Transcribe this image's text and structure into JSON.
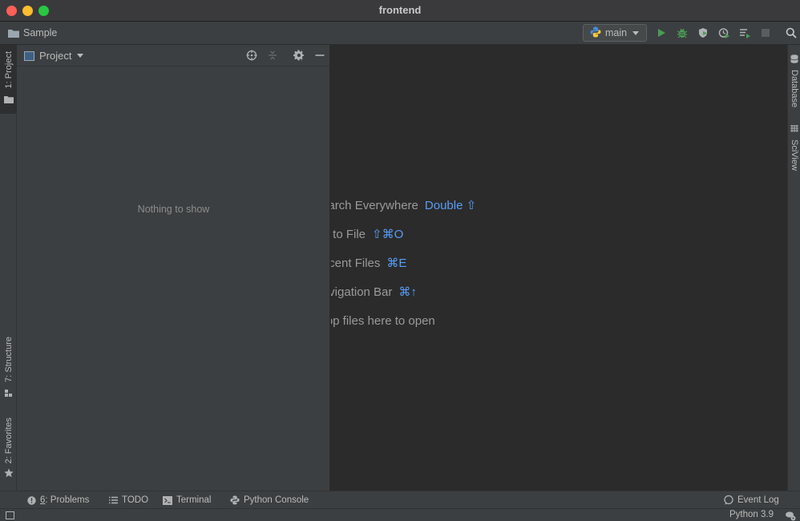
{
  "window": {
    "title": "frontend"
  },
  "navbar": {
    "breadcrumb": "Sample",
    "breadcrumb_icon": "folder-icon",
    "run_config": "main",
    "run_config_icon": "python-icon",
    "actions": [
      "run-icon",
      "debug-icon",
      "coverage-icon",
      "profile-icon",
      "run-tasks-icon",
      "stop-icon",
      "search-icon"
    ]
  },
  "left_stripe": {
    "tabs": [
      {
        "label": "1: Project",
        "active": true
      },
      {
        "label": "7: Structure",
        "active": false
      },
      {
        "label": "2: Favorites",
        "active": false
      }
    ]
  },
  "right_stripe": {
    "tabs": [
      {
        "label": "Database"
      },
      {
        "label": "SciView"
      }
    ]
  },
  "project_panel": {
    "title": "Project",
    "empty_text": "Nothing to show",
    "header_icons": [
      "locate-icon",
      "collapse-all-icon",
      "gear-icon",
      "minimize-icon"
    ]
  },
  "editor": {
    "hints": [
      {
        "text": "Search Everywhere",
        "key": "Double ⇧"
      },
      {
        "text": "Go to File",
        "key": "⇧⌘O"
      },
      {
        "text": "Recent Files",
        "key": "⌘E"
      },
      {
        "text": "Navigation Bar",
        "key": "⌘↑"
      },
      {
        "text": "Drop files here to open",
        "key": ""
      }
    ]
  },
  "bottom_bar": {
    "problems_number": "6",
    "problems_label": ": Problems",
    "todo": "TODO",
    "terminal": "Terminal",
    "python_console": "Python Console",
    "event_log": "Event Log"
  },
  "status_bar": {
    "interpreter": "Python 3.9"
  },
  "colors": {
    "accent_key": "#589df6",
    "run_green": "#499c54",
    "panel_bg": "#3c3f41",
    "editor_bg": "#2b2b2b"
  }
}
